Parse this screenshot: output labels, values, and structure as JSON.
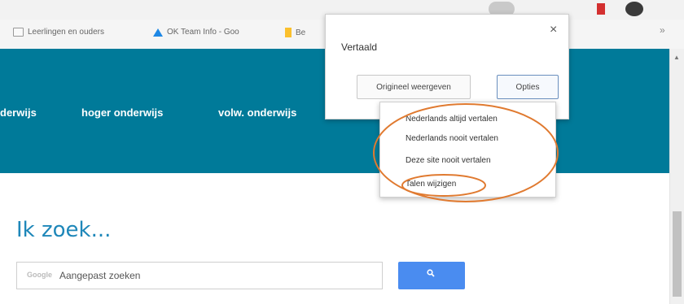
{
  "bookmarks": [
    {
      "label": "Leerlingen en ouders",
      "icon": "folder-icon"
    },
    {
      "label": "OK Team Info - Goo",
      "icon": "google-drive-icon"
    },
    {
      "label": "Be",
      "icon": "bookmark-icon"
    }
  ],
  "nav": {
    "items": [
      "derwijs",
      "hoger onderwijs",
      "volw. onderwijs"
    ]
  },
  "translate_popup": {
    "title": "Vertaald",
    "close": "×",
    "original_button": "Origineel weergeven",
    "options_button": "Opties",
    "menu_items": [
      "Nederlands altijd vertalen",
      "Nederlands nooit vertalen",
      "Deze site nooit vertalen",
      "Talen wijzigen"
    ]
  },
  "search": {
    "heading": "Ik zoek...",
    "google_label": "Google",
    "placeholder": "Aangepast zoeken",
    "button_icon": "search-icon"
  },
  "colors": {
    "nav_background": "#007a99",
    "search_button": "#4a8cf0",
    "annotation": "#e07a30"
  }
}
